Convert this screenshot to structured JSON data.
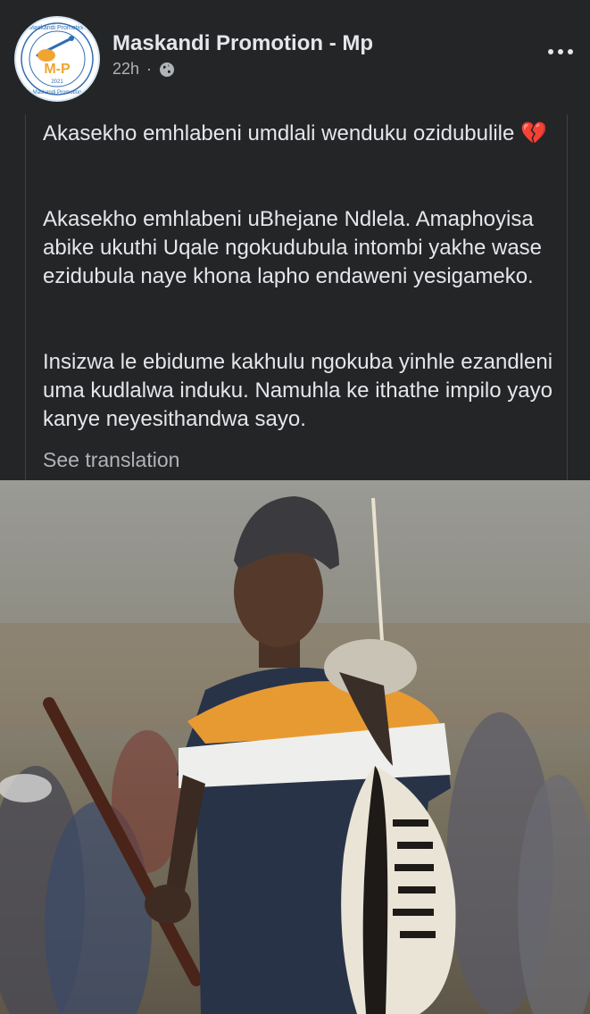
{
  "post": {
    "page_name": "Maskandi Promotion - Mp",
    "time": "22h",
    "dot": "·",
    "audience_icon": "globe-icon",
    "menu_icon": "more-dots-icon"
  },
  "avatar": {
    "logo_text": "M-P",
    "ring_text_top": "Maskandi Promotion",
    "ring_text_bottom": "Maskandi Promotion",
    "year": "2021"
  },
  "content": {
    "p1": "Akasekho emhlabeni umdlali wenduku ozidubulile 💔",
    "p2": "Akasekho emhlabeni uBhejane Ndlela. Amaphoyisa abike ukuthi Uqale ngokudubula intombi yakhe wase ezidubula naye khona lapho endaweni yesigameko.",
    "p3": "Insizwa le ebidume kakhulu ngokuba yinhle ezandleni uma kudlalwa induku. Namuhla ke ithathe impilo yayo kanye neyesithandwa sayo.",
    "see_translation": "See translation"
  },
  "colors": {
    "background": "#242526",
    "text": "#e4e6eb",
    "muted": "#b0b3b8",
    "logo_orange": "#f0a531",
    "logo_blue": "#2f6db5"
  }
}
